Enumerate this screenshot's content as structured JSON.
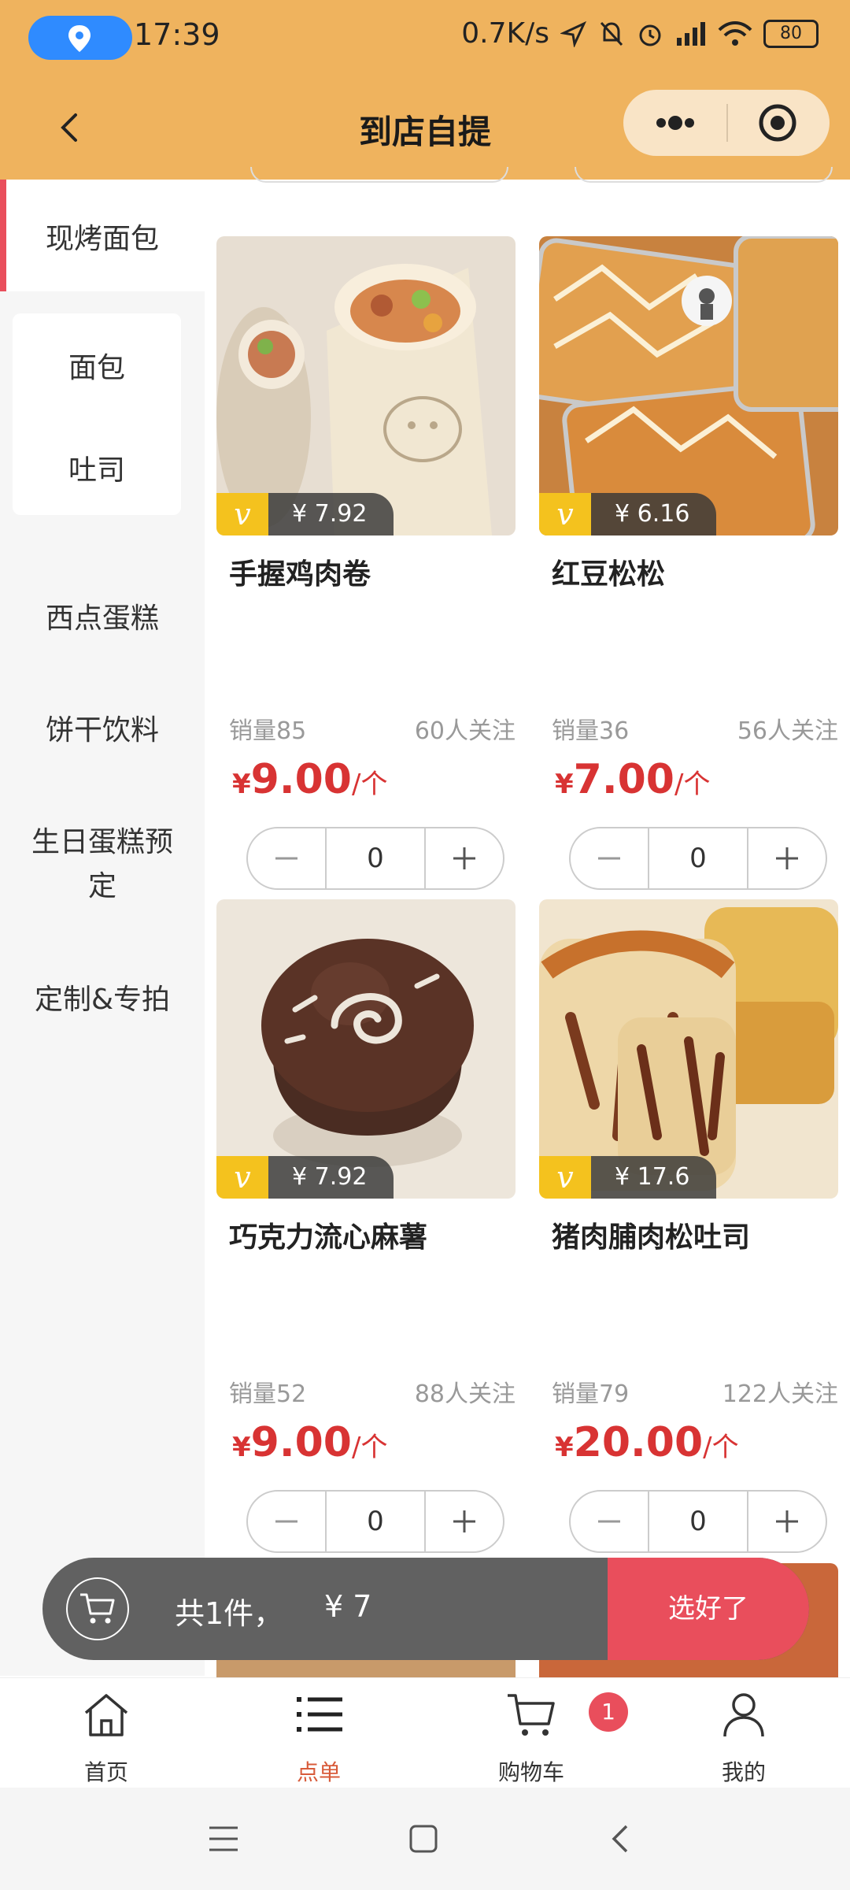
{
  "status": {
    "time": "17:39",
    "speed": "0.7K/s",
    "battery": "80"
  },
  "header": {
    "title": "到店自提"
  },
  "sidebar": {
    "active": "现烤面包",
    "subitems": [
      "面包",
      "吐司"
    ],
    "items": [
      "西点蛋糕",
      "饼干饮料",
      "生日蛋糕预定",
      "定制&专拍"
    ]
  },
  "products": [
    {
      "name": "手握鸡肉卷",
      "vip_price": "¥ 7.92",
      "sales": "销量85",
      "fans": "60人关注",
      "currency": "¥",
      "price": "9.00",
      "unit": "/个",
      "qty": "0"
    },
    {
      "name": "红豆松松",
      "vip_price": "¥ 6.16",
      "sales": "销量36",
      "fans": "56人关注",
      "currency": "¥",
      "price": "7.00",
      "unit": "/个",
      "qty": "0"
    },
    {
      "name": "巧克力流心麻薯",
      "vip_price": "¥ 7.92",
      "sales": "销量52",
      "fans": "88人关注",
      "currency": "¥",
      "price": "9.00",
      "unit": "/个",
      "qty": "0"
    },
    {
      "name": "猪肉脯肉松吐司",
      "vip_price": "¥ 17.6",
      "sales": "销量79",
      "fans": "122人关注",
      "currency": "¥",
      "price": "20.00",
      "unit": "/个",
      "qty": "0"
    }
  ],
  "vip_badge": "v",
  "cart": {
    "summary": "共1件，",
    "amount": "¥ 7",
    "checkout": "选好了"
  },
  "tabs": [
    {
      "label": "首页",
      "icon": "home-icon"
    },
    {
      "label": "点单",
      "icon": "list-icon"
    },
    {
      "label": "购物车",
      "icon": "cart-icon"
    },
    {
      "label": "我的",
      "icon": "user-icon"
    }
  ],
  "cart_badge": "1",
  "colors": {
    "brand": "#EFB35E",
    "accent": "#E94E5C",
    "price": "#D83333",
    "vip": "#F4C21E"
  }
}
